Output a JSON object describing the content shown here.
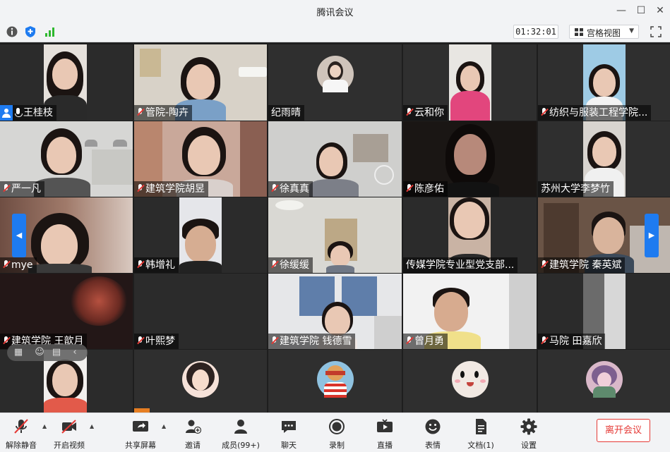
{
  "window": {
    "title": "腾讯会议"
  },
  "topbar": {
    "timer": "01:32:01",
    "view_label": "宫格视图"
  },
  "participants": [
    "王桂枝",
    "管院-陶卉",
    "纪雨晴",
    "云和你",
    "纺织与服装工程学院...",
    "严一凡",
    "建筑学院胡昱",
    "徐真真",
    "陈彦佑",
    "苏州大学李梦竹",
    "mye",
    "韩增礼",
    "徐缓缓",
    "传媒学院专业型党支部...",
    "建筑学院 秦英斌",
    "建筑学院 王歆月",
    "叶熙梦",
    "建筑学院 钱德雪",
    "曾月勇",
    "马院 田嘉欣"
  ],
  "controls": {
    "unmute": "解除静音",
    "start_video": "开启视频",
    "share_screen": "共享屏幕",
    "invite": "邀请",
    "members": "成员(99+)",
    "chat": "聊天",
    "record": "录制",
    "live": "直播",
    "reactions": "表情",
    "docs": "文档(1)",
    "settings": "设置",
    "leave": "离开会议"
  },
  "colors": {
    "accent": "#1e7bf0",
    "danger": "#e53935"
  }
}
